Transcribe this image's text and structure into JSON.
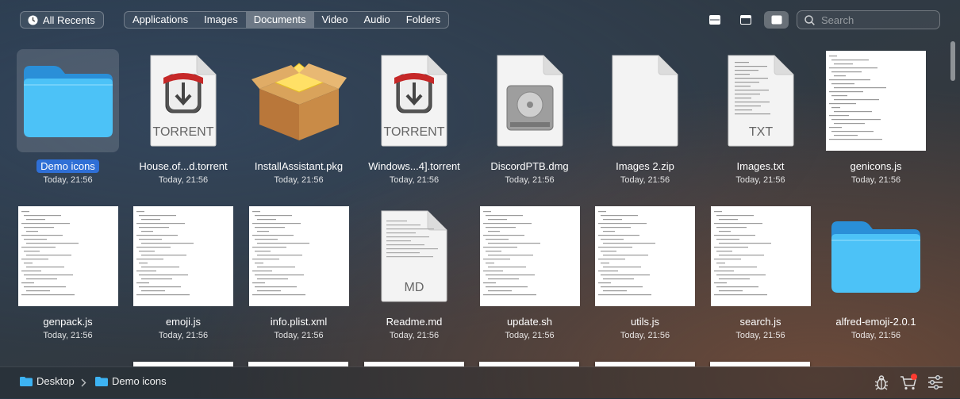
{
  "toolbar": {
    "recents_label": "All Recents",
    "categories": [
      "Applications",
      "Images",
      "Documents",
      "Video",
      "Audio",
      "Folders"
    ],
    "active_category": "Documents",
    "search_placeholder": "Search"
  },
  "files": [
    {
      "name": "Demo icons",
      "date": "Today, 21:56",
      "kind": "folder",
      "selected": true
    },
    {
      "name": "House.of...d.torrent",
      "date": "Today, 21:56",
      "kind": "torrent",
      "badge": "TORRENT"
    },
    {
      "name": "InstallAssistant.pkg",
      "date": "Today, 21:56",
      "kind": "pkg"
    },
    {
      "name": "Windows...4].torrent",
      "date": "Today, 21:56",
      "kind": "torrent",
      "badge": "TORRENT"
    },
    {
      "name": "DiscordPTB.dmg",
      "date": "Today, 21:56",
      "kind": "dmg"
    },
    {
      "name": "Images 2.zip",
      "date": "Today, 21:56",
      "kind": "blank"
    },
    {
      "name": "Images.txt",
      "date": "Today, 21:56",
      "kind": "txt",
      "badge": "TXT"
    },
    {
      "name": "genicons.js",
      "date": "Today, 21:56",
      "kind": "code"
    },
    {
      "name": "genpack.js",
      "date": "Today, 21:56",
      "kind": "code"
    },
    {
      "name": "emoji.js",
      "date": "Today, 21:56",
      "kind": "code"
    },
    {
      "name": "info.plist.xml",
      "date": "Today, 21:56",
      "kind": "code"
    },
    {
      "name": "Readme.md",
      "date": "Today, 21:56",
      "kind": "md",
      "badge": "MD"
    },
    {
      "name": "update.sh",
      "date": "Today, 21:56",
      "kind": "code"
    },
    {
      "name": "utils.js",
      "date": "Today, 21:56",
      "kind": "code"
    },
    {
      "name": "search.js",
      "date": "Today, 21:56",
      "kind": "code"
    },
    {
      "name": "alfred-emoji-2.0.1",
      "date": "Today, 21:56",
      "kind": "folder"
    }
  ],
  "breadcrumb": [
    {
      "label": "Desktop",
      "icon": "folder-icon"
    },
    {
      "label": "Demo icons",
      "icon": "folder-icon"
    }
  ],
  "bottom_icons": [
    "bug-icon",
    "cart-icon",
    "sliders-icon"
  ],
  "colors": {
    "selection": "#2f6fd6",
    "folder": "#3db3f3",
    "badge": "#ff3b30"
  }
}
